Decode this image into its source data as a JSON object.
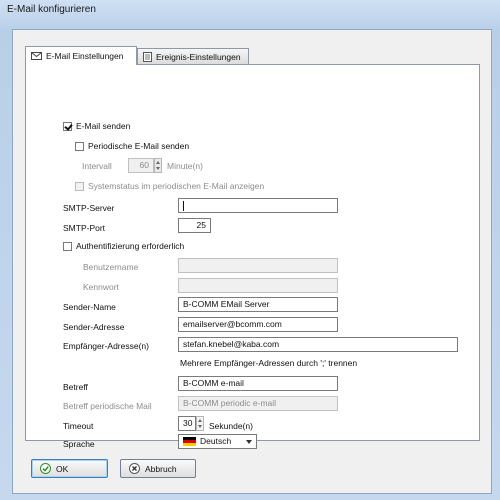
{
  "window": {
    "title": "E-Mail konfigurieren"
  },
  "tabs": [
    {
      "label": "E-Mail Einstellungen",
      "icon": "envelope-icon",
      "active": true
    },
    {
      "label": "Ereignis-Einstellungen",
      "icon": "document-icon",
      "active": false
    }
  ],
  "form": {
    "email_send": {
      "label": "E-Mail senden",
      "checked": true
    },
    "periodic": {
      "label": "Periodische E-Mail senden",
      "checked": false
    },
    "interval": {
      "label": "Intervall",
      "value": "60",
      "unit": "Minute(n)"
    },
    "system_status": {
      "label": "Systemstatus im periodischen E-Mail anzeigen",
      "checked": false
    },
    "smtp_server": {
      "label": "SMTP-Server",
      "value": ""
    },
    "smtp_port": {
      "label": "SMTP-Port",
      "value": "25"
    },
    "auth": {
      "label": "Authentifizierung erforderlich",
      "checked": false
    },
    "username": {
      "label": "Benutzername",
      "value": ""
    },
    "password": {
      "label": "Kennwort",
      "value": ""
    },
    "sender_name": {
      "label": "Sender-Name",
      "value": "B-COMM EMail Server"
    },
    "sender_address": {
      "label": "Sender-Adresse",
      "value": "emailserver@bcomm.com"
    },
    "recipient": {
      "label": "Empfänger-Adresse(n)",
      "value": "stefan.knebel@kaba.com",
      "hint": "Mehrere Empfänger-Adressen durch ';' trennen"
    },
    "subject": {
      "label": "Betreff",
      "value": "B-COMM e-mail"
    },
    "subject_periodic": {
      "label": "Betreff periodische Mail",
      "value": "B-COMM periodic e-mail"
    },
    "timeout": {
      "label": "Timeout",
      "value": "30",
      "unit": "Sekunde(n)"
    },
    "language": {
      "label": "Sprache",
      "value": "Deutsch",
      "icon": "german-flag-icon"
    }
  },
  "buttons": {
    "ok": "OK",
    "cancel": "Abbruch"
  },
  "colors": {
    "ok_icon": "#2e8b2e",
    "cancel_icon": "#555555",
    "default_border": "#3c7fb1"
  }
}
